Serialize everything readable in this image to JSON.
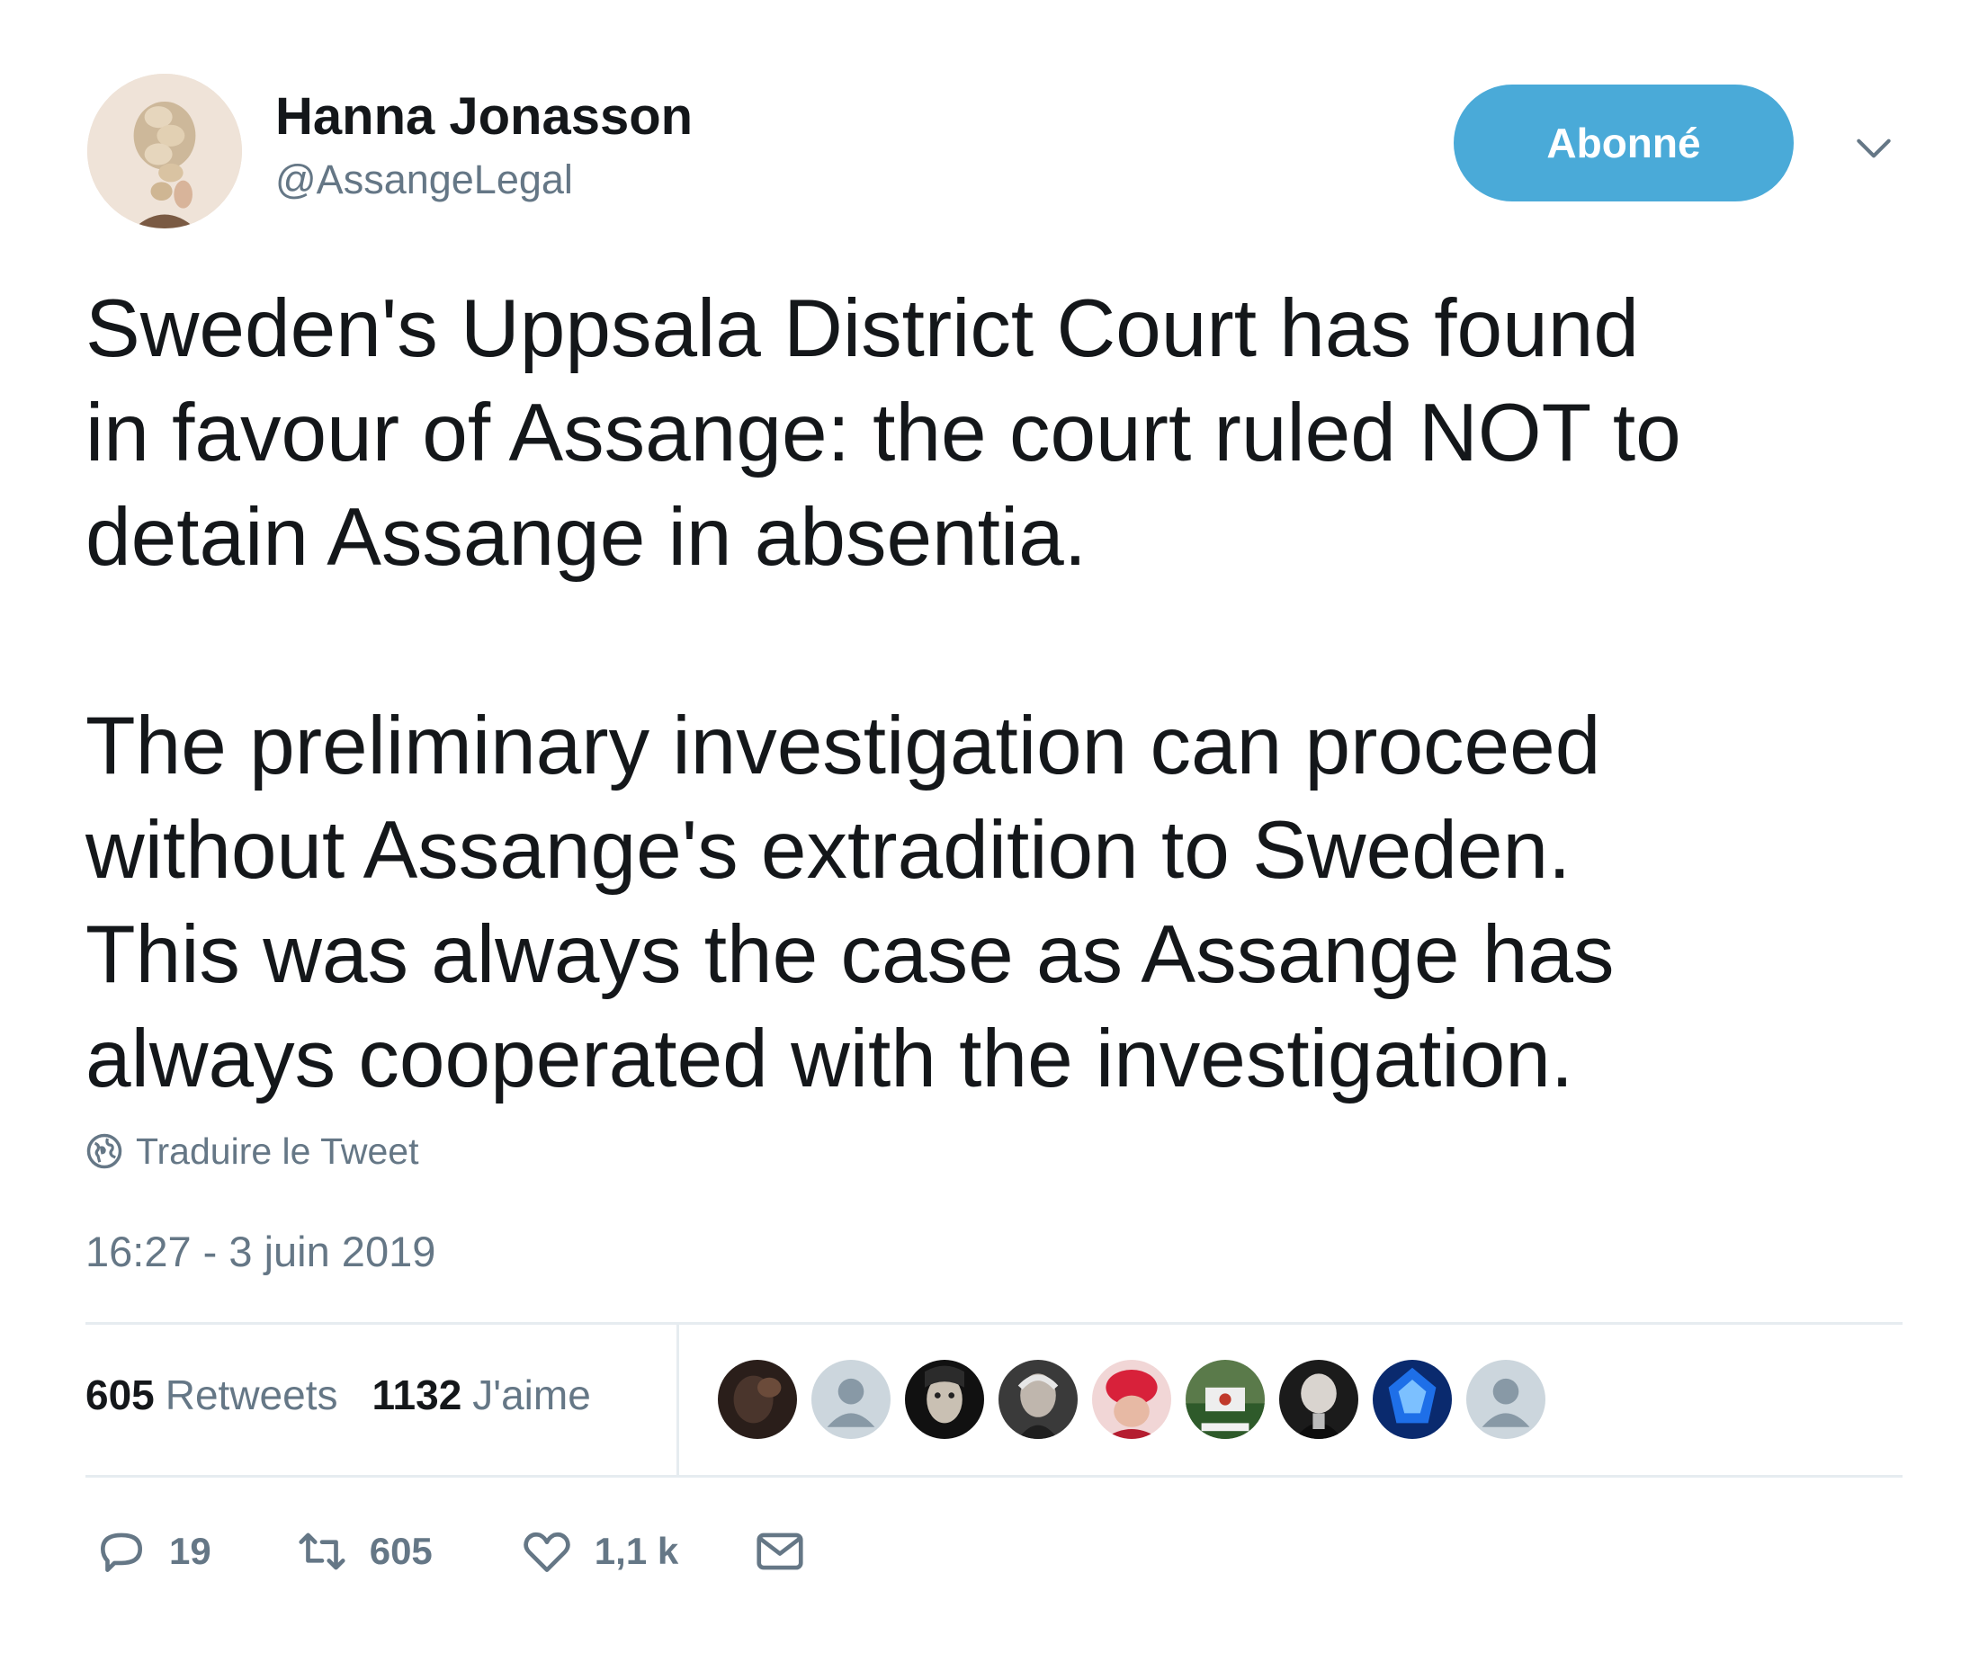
{
  "author": {
    "name": "Hanna Jonasson",
    "handle": "@AssangeLegal",
    "avatar_icon": "braided-hair-avatar"
  },
  "follow_button": {
    "label": "Abonné",
    "color": "#4aaad8"
  },
  "menu_icon": "chevron-down-icon",
  "tweet": {
    "paragraph1": [
      "Sweden's Uppsala District Court has found",
      "in favour of Assange: the court ruled NOT to",
      "detain Assange in absentia."
    ],
    "paragraph2": [
      "The preliminary investigation can proceed",
      "without Assange's extradition to Sweden.",
      "This was always the case as Assange has",
      "always cooperated with the investigation."
    ]
  },
  "translate": {
    "label": "Traduire le Tweet",
    "icon": "globe-icon"
  },
  "timestamp": "16:27 - 3 juin 2019",
  "stats": {
    "retweets_count": "605",
    "retweets_label": "Retweets",
    "likes_count": "1132",
    "likes_label": "J'aime"
  },
  "likers": [
    {
      "name": "liker-avatar-1"
    },
    {
      "name": "liker-avatar-default-2"
    },
    {
      "name": "liker-avatar-3"
    },
    {
      "name": "liker-avatar-4"
    },
    {
      "name": "liker-avatar-5"
    },
    {
      "name": "liker-avatar-6"
    },
    {
      "name": "liker-avatar-7"
    },
    {
      "name": "liker-avatar-8"
    },
    {
      "name": "liker-avatar-default-9"
    }
  ],
  "actions": {
    "reply_count": "19",
    "retweet_count": "605",
    "like_count": "1,1 k"
  },
  "colors": {
    "text": "#14171a",
    "secondary": "#657786",
    "divider": "#e6ecf0",
    "accent": "#4aaad8"
  }
}
